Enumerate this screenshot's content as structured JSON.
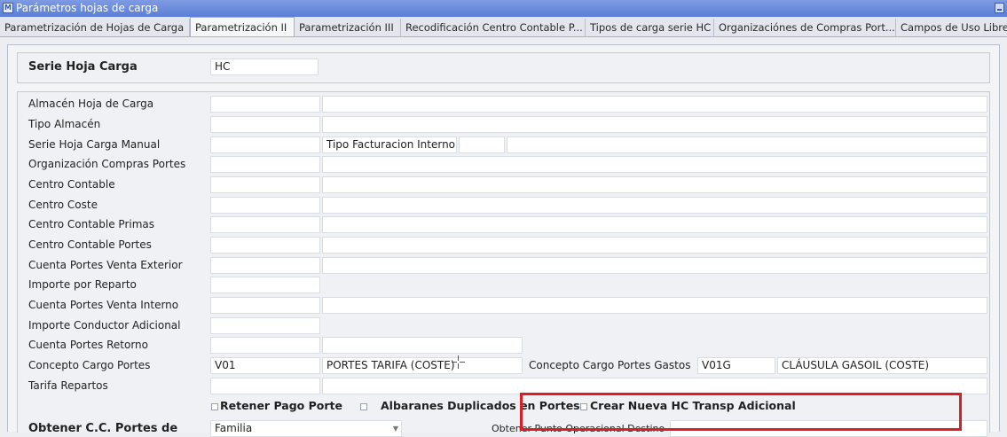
{
  "window": {
    "title": "Parámetros hojas de carga"
  },
  "tabs": [
    {
      "label": "Parametrización de Hojas de Carga"
    },
    {
      "label": "Parametrización II"
    },
    {
      "label": "Parametrización III"
    },
    {
      "label": "Recodificación Centro Contable P..."
    },
    {
      "label": "Tipos de carga serie HC"
    },
    {
      "label": "Organizaciónes de Compras Port..."
    },
    {
      "label": "Campos de Uso Libre"
    }
  ],
  "serie": {
    "label": "Serie Hoja Carga",
    "value": "HC"
  },
  "fields": [
    {
      "label": "Almacén Hoja de Carga",
      "code": "",
      "desc": ""
    },
    {
      "label": "Tipo Almacén",
      "code": "",
      "desc": ""
    },
    {
      "label": "Serie Hoja Carga Manual",
      "code": "",
      "extra_label": "Tipo Facturacion Interno",
      "extra_code": "",
      "extra_desc": ""
    },
    {
      "label": "Organización Compras Portes",
      "code": "",
      "desc": ""
    },
    {
      "label": "Centro Contable",
      "code": "",
      "desc": ""
    },
    {
      "label": "Centro Coste",
      "code": "",
      "desc": ""
    },
    {
      "label": "Centro Contable Primas",
      "code": "",
      "desc": ""
    },
    {
      "label": "Centro Contable Portes",
      "code": "",
      "desc": ""
    },
    {
      "label": "Cuenta Portes Venta Exterior",
      "code": "",
      "desc": ""
    },
    {
      "label": "Importe por Reparto",
      "code": ""
    },
    {
      "label": "Cuenta Portes Venta Interno",
      "code": "",
      "desc": ""
    },
    {
      "label": "Importe Conductor Adicional",
      "code": ""
    },
    {
      "label": "Cuenta Portes Retorno",
      "code": "",
      "desc": ""
    },
    {
      "label": "Concepto Cargo Portes",
      "code": "V01",
      "desc": "PORTES TARIFA (COSTE)",
      "extra_label": "Concepto Cargo Portes Gastos",
      "extra_code": "V01G",
      "extra_desc": "CLÁUSULA GASOIL (COSTE)"
    },
    {
      "label": "Tarifa Repartos",
      "code": "",
      "desc": ""
    }
  ],
  "checkboxes": [
    {
      "label": "Retener Pago Porte",
      "checked": false
    },
    {
      "label": "Albaranes Duplicados en Portes",
      "checked": false
    },
    {
      "label": "Crear Nueva HC Transp Adicional",
      "checked": false
    }
  ],
  "cutoff_row": {
    "label": "Obtener C.C. Portes de",
    "value": "Familia",
    "right_label": "Obtener Punto Operacional Destino"
  }
}
